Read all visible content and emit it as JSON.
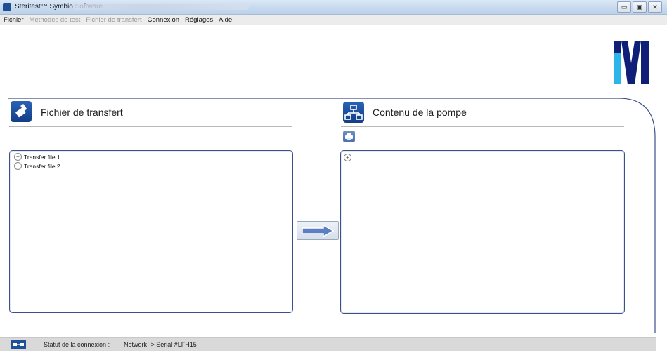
{
  "window": {
    "title": "Steritest™ Symbio Software",
    "controls": [
      "minimize-icon",
      "maximize-icon",
      "close-icon"
    ]
  },
  "menu": {
    "items": [
      {
        "label": "Fichier",
        "enabled": true
      },
      {
        "label": "Méthodes de test",
        "enabled": false
      },
      {
        "label": "Fichier de transfert",
        "enabled": false
      },
      {
        "label": "Connexion",
        "enabled": true
      },
      {
        "label": "Réglages",
        "enabled": true
      },
      {
        "label": "Aide",
        "enabled": true
      }
    ]
  },
  "logo": {
    "letter": "M",
    "colors": [
      "#2bb5e8",
      "#0f1f78"
    ]
  },
  "left_panel": {
    "title": "Fichier de transfert",
    "icon": "brush-icon",
    "tree": [
      {
        "label": "Transfer file 1",
        "expander": "+"
      },
      {
        "label": "Transfer file 2",
        "expander": "+"
      }
    ]
  },
  "transfer_button": {
    "icon": "arrow-right-icon"
  },
  "right_panel": {
    "title": "Contenu de la pompe",
    "icon": "network-icon",
    "toolbar_icon": "printer-icon",
    "tree_expander": "+"
  },
  "status": {
    "label": "Statut de la connexion :",
    "value": "Network -> Serial #LFH15",
    "icon": "connection-icon"
  },
  "colors": {
    "accent": "#1a4d9a",
    "frame": "#3d4f8a",
    "statusbar": "#d9d9d9"
  }
}
